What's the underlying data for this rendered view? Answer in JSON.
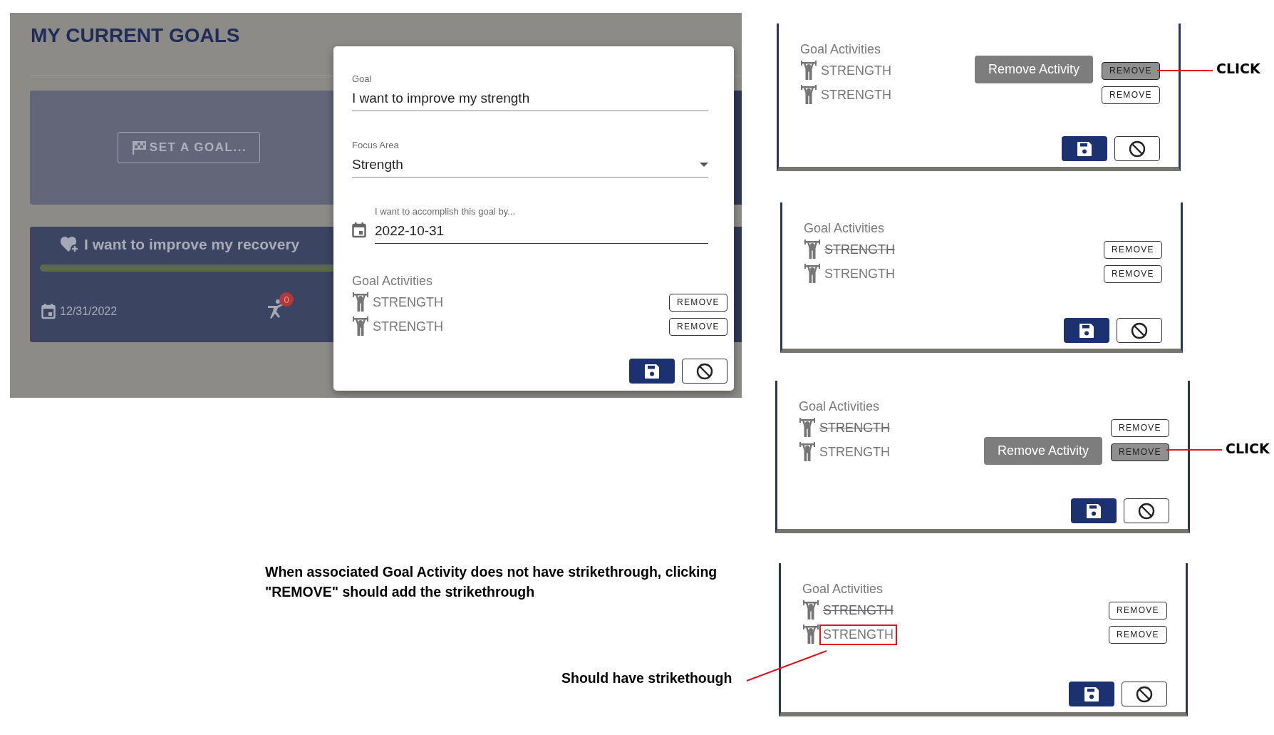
{
  "main_screenshot": {
    "page_title": "MY CURRENT GOALS",
    "set_goal_button": "SET A GOAL...",
    "goal_card": {
      "title": "I want to improve my recovery",
      "date": "12/31/2022",
      "badge": "0",
      "progress": {
        "level": 1
      }
    },
    "dialog": {
      "goal": {
        "label": "Goal",
        "value": "I want to improve my strength"
      },
      "focus_area": {
        "label": "Focus Area",
        "value": "Strength"
      },
      "date_field": {
        "label": "I want to accomplish this goal by...",
        "value": "2022-10-31"
      },
      "activities_label": "Goal Activities",
      "activities": [
        {
          "name": "STRENGTH",
          "struck": false,
          "highlighted": false,
          "button": "REMOVE",
          "pressed": false
        },
        {
          "name": "STRENGTH",
          "struck": false,
          "highlighted": false,
          "button": "REMOVE",
          "pressed": false
        }
      ]
    }
  },
  "steps": [
    {
      "activities_label": "Goal Activities",
      "tooltip": "Remove Activity",
      "click_label": "CLICK",
      "activities": [
        {
          "name": "STRENGTH",
          "struck": false,
          "highlighted": false,
          "button": "REMOVE",
          "pressed": true
        },
        {
          "name": "STRENGTH",
          "struck": false,
          "highlighted": false,
          "button": "REMOVE",
          "pressed": false
        }
      ]
    },
    {
      "activities_label": "Goal Activities",
      "activities": [
        {
          "name": "STRENGTH",
          "struck": true,
          "highlighted": false,
          "button": "REMOVE",
          "pressed": false
        },
        {
          "name": "STRENGTH",
          "struck": false,
          "highlighted": false,
          "button": "REMOVE",
          "pressed": false
        }
      ]
    },
    {
      "activities_label": "Goal Activities",
      "tooltip": "Remove Activity",
      "click_label": "CLICK",
      "activities": [
        {
          "name": "STRENGTH",
          "struck": true,
          "highlighted": false,
          "button": "REMOVE",
          "pressed": false
        },
        {
          "name": "STRENGTH",
          "struck": false,
          "highlighted": false,
          "button": "REMOVE",
          "pressed": true
        }
      ]
    },
    {
      "activities_label": "Goal Activities",
      "activities": [
        {
          "name": "STRENGTH",
          "struck": true,
          "highlighted": false,
          "button": "REMOVE",
          "pressed": false
        },
        {
          "name": "STRENGTH",
          "struck": false,
          "highlighted": true,
          "button": "REMOVE",
          "pressed": false
        }
      ]
    }
  ],
  "annotations": {
    "note": "When associated Goal Activity does not have strikethrough, clicking \"REMOVE\" should add the strikethrough",
    "expected": "Should have strikethough"
  }
}
